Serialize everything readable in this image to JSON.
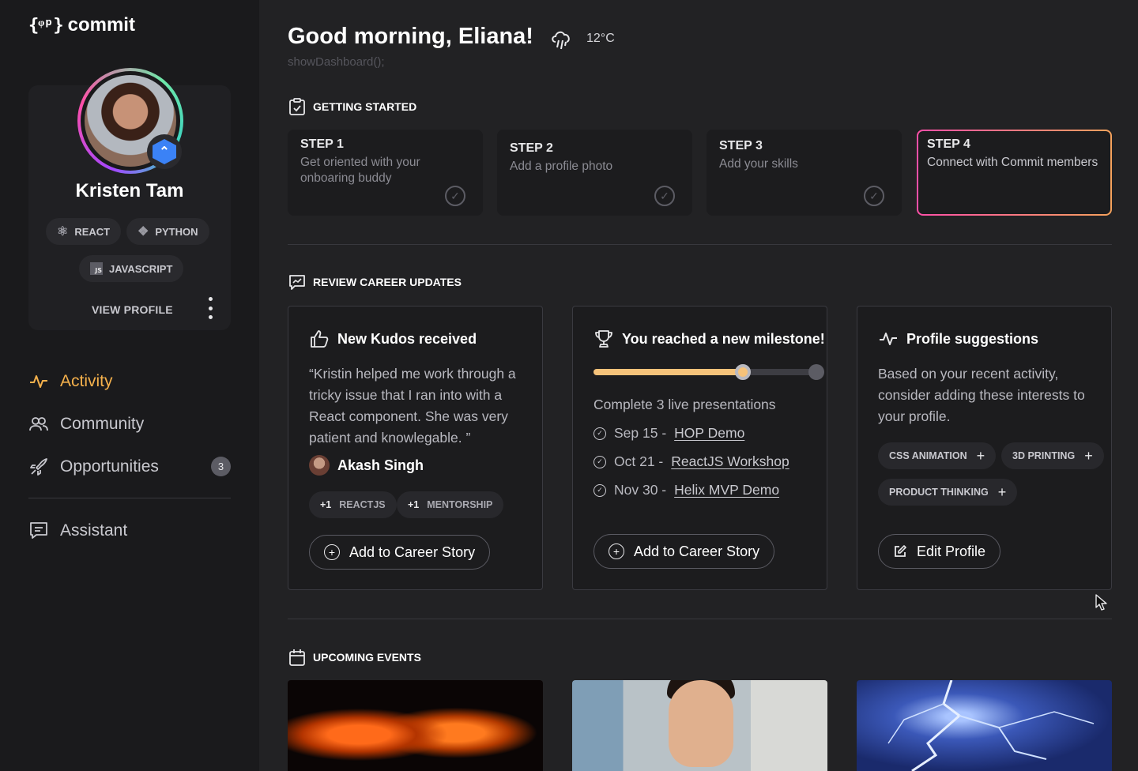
{
  "app": {
    "logo_mark": "{ᵠᵖ}",
    "logo_text": "commit"
  },
  "profile": {
    "name": "Kristen Tam",
    "skills": [
      "REACT",
      "PYTHON",
      "JAVASCRIPT"
    ],
    "view_profile_label": "VIEW PROFILE"
  },
  "nav": {
    "activity": "Activity",
    "community": "Community",
    "opportunities": "Opportunities",
    "opportunities_count": "3",
    "assistant": "Assistant"
  },
  "header": {
    "greeting": "Good morning, Eliana!",
    "temperature": "12°C",
    "code_hint": "showDashboard();"
  },
  "getting_started": {
    "title": "GETTING STARTED",
    "steps": [
      {
        "label": "STEP 1",
        "desc": "Get oriented with your onboaring buddy",
        "done": true
      },
      {
        "label": "STEP 2",
        "desc": "Add a profile photo",
        "done": true
      },
      {
        "label": "STEP 3",
        "desc": "Add your skills",
        "done": true
      },
      {
        "label": "STEP 4",
        "desc": "Connect with Commit members",
        "done": false
      }
    ]
  },
  "career_updates": {
    "title": "REVIEW CAREER UPDATES",
    "kudos": {
      "title": "New Kudos received",
      "quote": "“Kristin helped me work through a tricky issue that I ran into with a React component. She was very patient and knowlegable. ”",
      "author": "Akash Singh",
      "tags": [
        {
          "count": "+1",
          "label": "REACTJS"
        },
        {
          "count": "+1",
          "label": "MENTORSHIP"
        }
      ],
      "button": "Add to Career Story"
    },
    "milestone": {
      "title": "You reached a new milestone!",
      "progress": 0.66,
      "goal": "Complete 3 live presentations",
      "items": [
        {
          "date": "Sep 15 -",
          "event": "HOP Demo"
        },
        {
          "date": "Oct 21 -",
          "event": "ReactJS Workshop"
        },
        {
          "date": "Nov 30 -",
          "event": "Helix MVP Demo"
        }
      ],
      "button": "Add to Career Story"
    },
    "suggestions": {
      "title": "Profile suggestions",
      "text": "Based on your recent activity, consider adding these interests to your profile.",
      "interests": [
        "CSS ANIMATION",
        "3D PRINTING",
        "PRODUCT THINKING"
      ],
      "button": "Edit Profile"
    }
  },
  "events": {
    "title": "UPCOMING EVENTS"
  },
  "colors": {
    "accent": "#f5b14c",
    "background": "#222224",
    "sidebar": "#1a1a1c",
    "badge": "#3b82f6"
  }
}
